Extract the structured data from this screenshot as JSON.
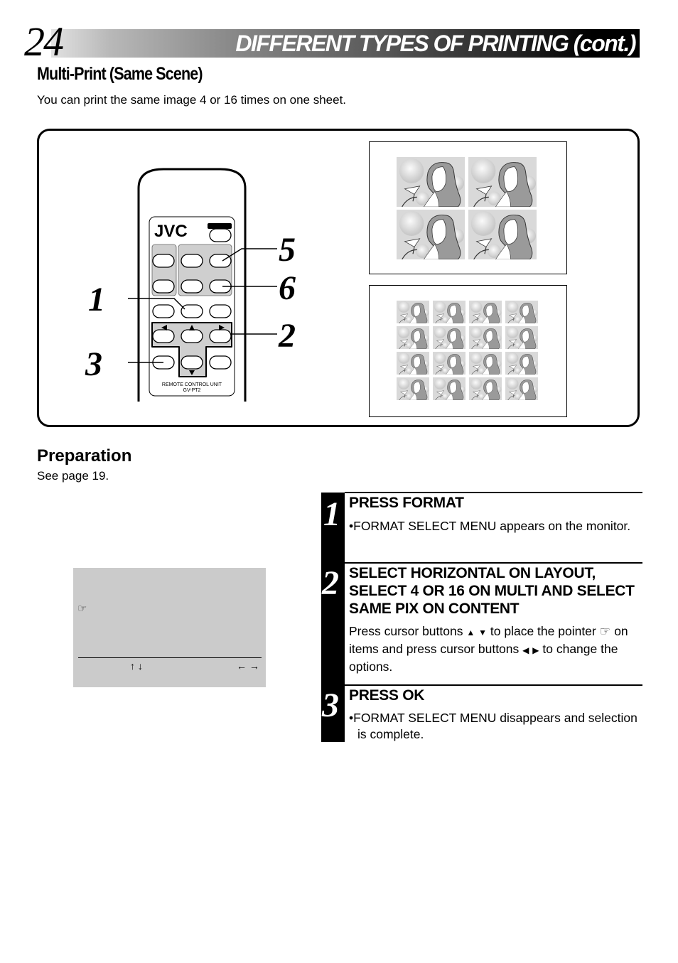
{
  "header": {
    "page_number": "24",
    "title": "DIFFERENT TYPES OF PRINTING (cont.)"
  },
  "section": {
    "title": "Multi-Print (Same Scene)",
    "subtitle": "You can print the same image 4 or 16 times on one sheet."
  },
  "illustration": {
    "remote": {
      "brand": "JVC",
      "label_line1": "REMOTE CONTROL UNIT",
      "label_line2": "GV-PT2"
    },
    "callouts": [
      "1",
      "2",
      "3",
      "5",
      "6"
    ],
    "sheets": [
      {
        "name": "4-image sheet",
        "rows": 2,
        "cols": 2
      },
      {
        "name": "16-image sheet",
        "rows": 4,
        "cols": 4
      }
    ]
  },
  "preparation": {
    "title": "Preparation",
    "text": "See page 19."
  },
  "monitor": {
    "pointer_icon": "pointing-hand",
    "up_down_arrows": "↑ ↓",
    "left_right_arrows": "← →",
    "background": "#cbcbcb"
  },
  "steps": [
    {
      "number": "1",
      "heading": "PRESS FORMAT",
      "body": "•FORMAT SELECT MENU appears on the monitor."
    },
    {
      "number": "2",
      "heading": "SELECT HORIZONTAL ON LAYOUT, SELECT 4 OR 16 ON MULTI AND SELECT SAME PIX ON CONTENT",
      "body_parts": [
        "Press cursor buttons",
        "to place the pointer",
        "on items and press cursor buttons",
        "to change the options."
      ]
    },
    {
      "number": "3",
      "heading": "PRESS OK",
      "body": "•FORMAT SELECT MENU disappears and selection is complete."
    }
  ]
}
